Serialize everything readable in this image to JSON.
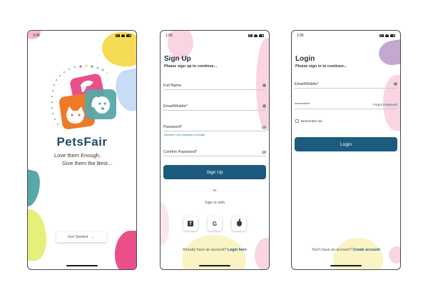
{
  "status": {
    "time": "1:05"
  },
  "splash": {
    "brand": "PetsFair",
    "tagline_1": "Love them Enough,",
    "tagline_2": "Give them the Best...",
    "get_started": "Get Started",
    "arrow": "→"
  },
  "signup": {
    "title": "Sign Up",
    "subtitle": "Please sign up to continue...",
    "full_name": "Full Name",
    "email": "Email/Mobile*",
    "password": "Password*",
    "password_hint": "Minimum of 8 characters in length.",
    "confirm_password": "Confirm Password*",
    "button": "Sign Up",
    "or": "or",
    "sign_in_with": "Sign in with",
    "have_account": "Already have an account?",
    "login_link": "Login here"
  },
  "login": {
    "title": "Login",
    "subtitle": "Please sign in to continue...",
    "email": "Email/Mobile*",
    "password_value": "**********",
    "forgot": "Forgot Password",
    "remember": "Remember me",
    "button": "Login",
    "no_account": "Don't have an account?",
    "create_link": "Create account"
  },
  "colors": {
    "primary": "#1c5b7d",
    "brand_text": "#1f4b63",
    "pink": "#ea4f8a",
    "orange": "#ee7a27",
    "teal": "#5aa7a8",
    "yellow": "#f6dc55",
    "blue": "#c7dcf5",
    "lime": "#e4f07a",
    "lilac": "#c3a8cf"
  },
  "icons": [
    "signal-icon",
    "wifi-icon",
    "battery-icon",
    "eye-off-icon",
    "facebook-icon",
    "google-icon",
    "apple-icon",
    "arrow-right-icon"
  ]
}
